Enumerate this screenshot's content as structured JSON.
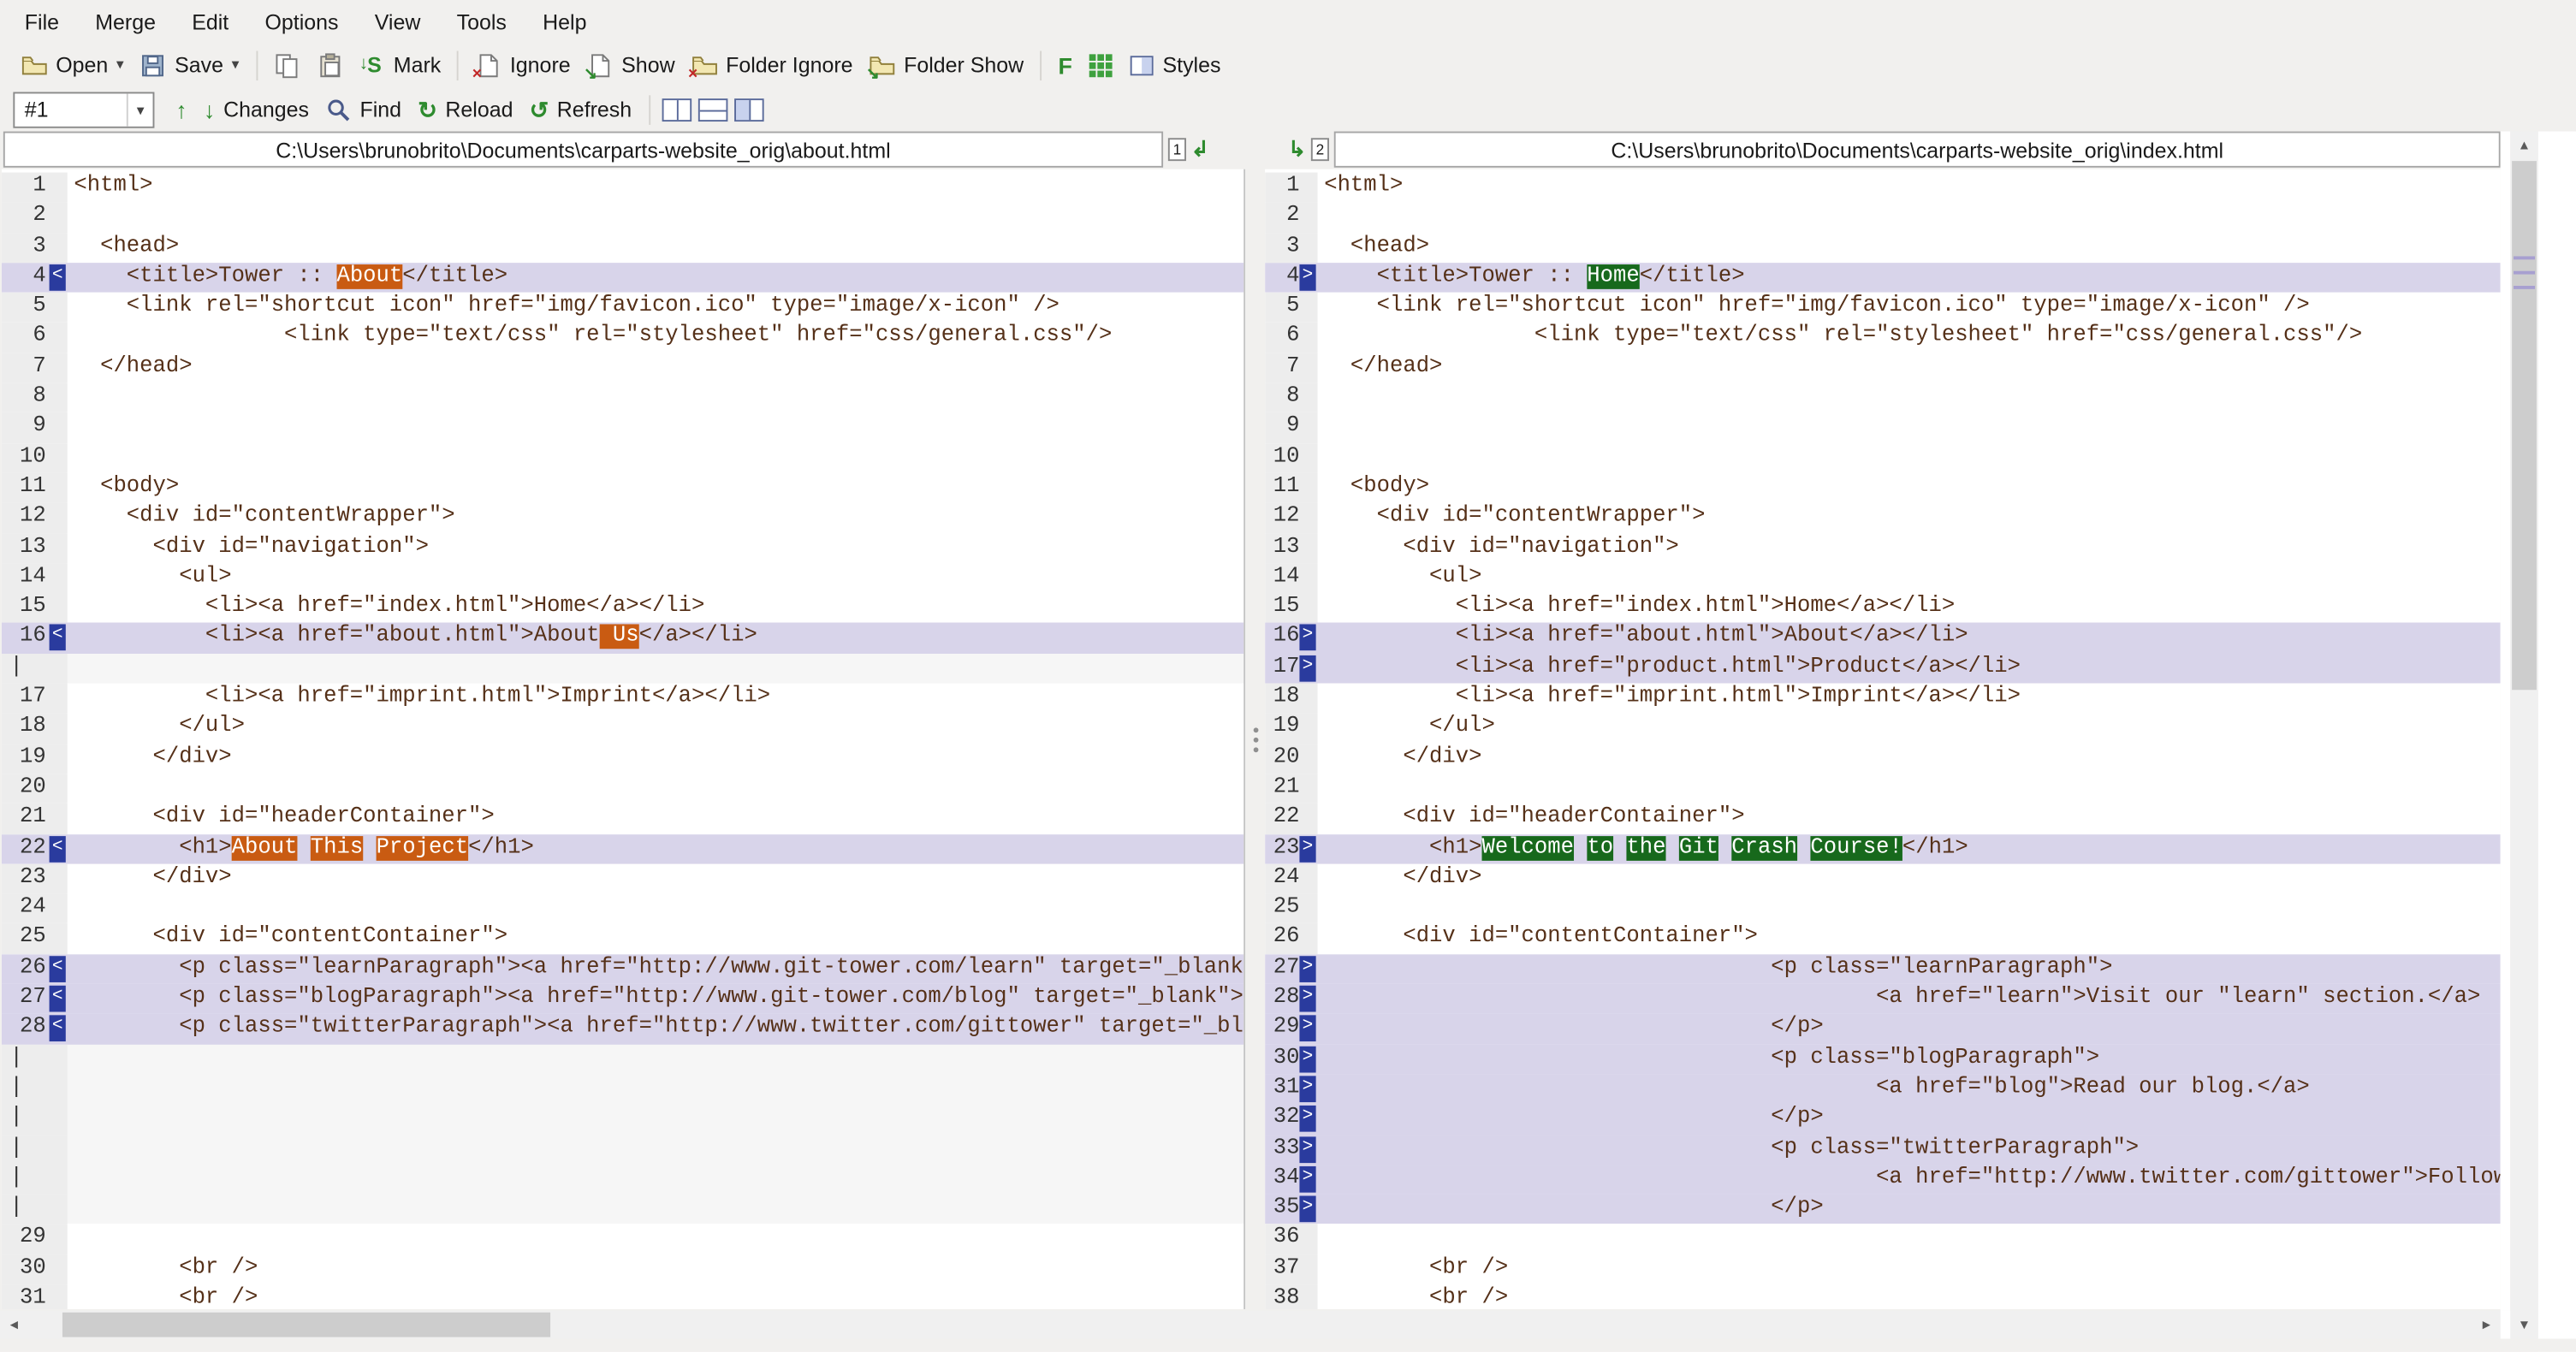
{
  "menu": {
    "items": [
      "File",
      "Merge",
      "Edit",
      "Options",
      "View",
      "Tools",
      "Help"
    ]
  },
  "toolbar": {
    "open": "Open",
    "save": "Save",
    "mark": "Mark",
    "ignore": "Ignore",
    "show": "Show",
    "folder_ignore": "Folder Ignore",
    "folder_show": "Folder Show",
    "font_badge": "F",
    "styles": "Styles"
  },
  "nav_toolbar": {
    "diff_selector": "#1",
    "changes": "Changes",
    "find": "Find",
    "reload": "Reload",
    "refresh": "Refresh"
  },
  "icons": {
    "caret": "▾",
    "prev_change": "↑",
    "next_change": "↓",
    "reload": "↻",
    "refresh": "↺",
    "mark_glyph": "S",
    "mark_arrow": "↓",
    "block_overlay": "×",
    "show_overlay": "↘",
    "merge_to_left": "↲",
    "merge_to_right": "↳",
    "scroll_up": "▲",
    "scroll_down": "▼",
    "scroll_left": "◄",
    "scroll_right": "►"
  },
  "filebar": {
    "left_path": "C:\\Users\\brunobrito\\Documents\\carparts-website_orig\\about.html",
    "right_path": "C:\\Users\\brunobrito\\Documents\\carparts-website_orig\\index.html",
    "pane1_badge": "1",
    "pane2_badge": "2"
  },
  "panes": {
    "gap_glyph": "|"
  },
  "left_pane": {
    "rows": [
      {
        "n": "1",
        "t": "<html>"
      },
      {
        "n": "2",
        "t": ""
      },
      {
        "n": "3",
        "t": "  <head>"
      },
      {
        "n": "4",
        "d": 1,
        "m": "<",
        "s": [
          "    <title>Tower :: ",
          [
            "About"
          ],
          "</title>"
        ]
      },
      {
        "n": "5",
        "t": "    <link rel=\"shortcut icon\" href=\"img/favicon.ico\" type=\"image/x-icon\" />"
      },
      {
        "n": "6",
        "t": "                <link type=\"text/css\" rel=\"stylesheet\" href=\"css/general.css\"/>"
      },
      {
        "n": "7",
        "t": "  </head>"
      },
      {
        "n": "8",
        "t": ""
      },
      {
        "n": "9",
        "t": ""
      },
      {
        "n": "10",
        "t": ""
      },
      {
        "n": "11",
        "t": "  <body>"
      },
      {
        "n": "12",
        "t": "    <div id=\"contentWrapper\">"
      },
      {
        "n": "13",
        "t": "      <div id=\"navigation\">"
      },
      {
        "n": "14",
        "t": "        <ul>"
      },
      {
        "n": "15",
        "t": "          <li><a href=\"index.html\">Home</a></li>"
      },
      {
        "n": "16",
        "d": 1,
        "m": "<",
        "s": [
          "          <li><a href=\"about.html\">About",
          [
            " Us"
          ],
          "</a></li>"
        ]
      },
      {
        "g": 1
      },
      {
        "n": "17",
        "t": "          <li><a href=\"imprint.html\">Imprint</a></li>"
      },
      {
        "n": "18",
        "t": "        </ul>"
      },
      {
        "n": "19",
        "t": "      </div>"
      },
      {
        "n": "20",
        "t": ""
      },
      {
        "n": "21",
        "t": "      <div id=\"headerContainer\">"
      },
      {
        "n": "22",
        "d": 1,
        "m": "<",
        "s": [
          "        <h1>",
          [
            "About"
          ],
          " ",
          [
            "This"
          ],
          " ",
          [
            "Project"
          ],
          "</h1>"
        ]
      },
      {
        "n": "23",
        "t": "      </div>"
      },
      {
        "n": "24",
        "t": ""
      },
      {
        "n": "25",
        "t": "      <div id=\"contentContainer\">"
      },
      {
        "n": "26",
        "d": 1,
        "m": "<",
        "t": "        <p class=\"learnParagraph\"><a href=\"http://www.git-tower.com/learn\" target=\"_blank\">Visit our \"learn\" section.</a></p>"
      },
      {
        "n": "27",
        "d": 1,
        "m": "<",
        "t": "        <p class=\"blogParagraph\"><a href=\"http://www.git-tower.com/blog\" target=\"_blank\">Read our blog.</a></p>"
      },
      {
        "n": "28",
        "d": 1,
        "m": "<",
        "t": "        <p class=\"twitterParagraph\"><a href=\"http://www.twitter.com/gittower\" target=\"_blank\">Follow us on Twitter.</a></p>"
      },
      {
        "g": 1
      },
      {
        "g": 1
      },
      {
        "g": 1
      },
      {
        "g": 1
      },
      {
        "g": 1
      },
      {
        "g": 1
      },
      {
        "n": "29",
        "t": ""
      },
      {
        "n": "30",
        "t": "        <br />"
      },
      {
        "n": "31",
        "t": "        <br />"
      }
    ]
  },
  "right_pane": {
    "rows": [
      {
        "n": "1",
        "t": "<html>"
      },
      {
        "n": "2",
        "t": ""
      },
      {
        "n": "3",
        "t": "  <head>"
      },
      {
        "n": "4",
        "d": 1,
        "m": ">",
        "s": [
          "    <title>Tower :: ",
          [
            "Home"
          ],
          "</title>"
        ]
      },
      {
        "n": "5",
        "t": "    <link rel=\"shortcut icon\" href=\"img/favicon.ico\" type=\"image/x-icon\" />"
      },
      {
        "n": "6",
        "t": "                <link type=\"text/css\" rel=\"stylesheet\" href=\"css/general.css\"/>"
      },
      {
        "n": "7",
        "t": "  </head>"
      },
      {
        "n": "8",
        "t": ""
      },
      {
        "n": "9",
        "t": ""
      },
      {
        "n": "10",
        "t": ""
      },
      {
        "n": "11",
        "t": "  <body>"
      },
      {
        "n": "12",
        "t": "    <div id=\"contentWrapper\">"
      },
      {
        "n": "13",
        "t": "      <div id=\"navigation\">"
      },
      {
        "n": "14",
        "t": "        <ul>"
      },
      {
        "n": "15",
        "t": "          <li><a href=\"index.html\">Home</a></li>"
      },
      {
        "n": "16",
        "d": 1,
        "m": ">",
        "t": "          <li><a href=\"about.html\">About</a></li>"
      },
      {
        "n": "17",
        "d": 1,
        "m": ">",
        "t": "          <li><a href=\"product.html\">Product</a></li>"
      },
      {
        "n": "18",
        "t": "          <li><a href=\"imprint.html\">Imprint</a></li>"
      },
      {
        "n": "19",
        "t": "        </ul>"
      },
      {
        "n": "20",
        "t": "      </div>"
      },
      {
        "n": "21",
        "t": ""
      },
      {
        "n": "22",
        "t": "      <div id=\"headerContainer\">"
      },
      {
        "n": "23",
        "d": 1,
        "m": ">",
        "s": [
          "        <h1>",
          [
            "Welcome"
          ],
          " ",
          [
            "to"
          ],
          " ",
          [
            "the"
          ],
          " ",
          [
            "Git"
          ],
          " ",
          [
            "Crash"
          ],
          " ",
          [
            "Course!"
          ],
          "</h1>"
        ]
      },
      {
        "n": "24",
        "t": "      </div>"
      },
      {
        "n": "25",
        "t": ""
      },
      {
        "n": "26",
        "t": "      <div id=\"contentContainer\">"
      },
      {
        "n": "27",
        "d": 1,
        "m": ">",
        "t": "                                  <p class=\"learnParagraph\">"
      },
      {
        "n": "28",
        "d": 1,
        "m": ">",
        "t": "                                          <a href=\"learn\">Visit our \"learn\" section.</a>"
      },
      {
        "n": "29",
        "d": 1,
        "m": ">",
        "t": "                                  </p>"
      },
      {
        "n": "30",
        "d": 1,
        "m": ">",
        "t": "                                  <p class=\"blogParagraph\">"
      },
      {
        "n": "31",
        "d": 1,
        "m": ">",
        "t": "                                          <a href=\"blog\">Read our blog.</a>"
      },
      {
        "n": "32",
        "d": 1,
        "m": ">",
        "t": "                                  </p>"
      },
      {
        "n": "33",
        "d": 1,
        "m": ">",
        "t": "                                  <p class=\"twitterParagraph\">"
      },
      {
        "n": "34",
        "d": 1,
        "m": ">",
        "t": "                                          <a href=\"http://www.twitter.com/gittower\">Follow us on Twitter.</a>"
      },
      {
        "n": "35",
        "d": 1,
        "m": ">",
        "t": "                                  </p>"
      },
      {
        "n": "36",
        "t": ""
      },
      {
        "n": "37",
        "t": "        <br />"
      },
      {
        "n": "38",
        "t": "        <br />"
      }
    ]
  },
  "colors": {
    "chrome_bg": "#f1f0ee",
    "diff_row": "#d8d4ea",
    "removed_word": "#c95b12",
    "added_word": "#17691c",
    "marker_bg": "#2a3b9e",
    "code_text": "#553018",
    "gutter_bg": "#ededed",
    "gutter_text": "#333333",
    "icon_green": "#2e8b2e",
    "scroll_thumb": "#cdcdcd",
    "scroll_track": "#f0f0f0"
  }
}
